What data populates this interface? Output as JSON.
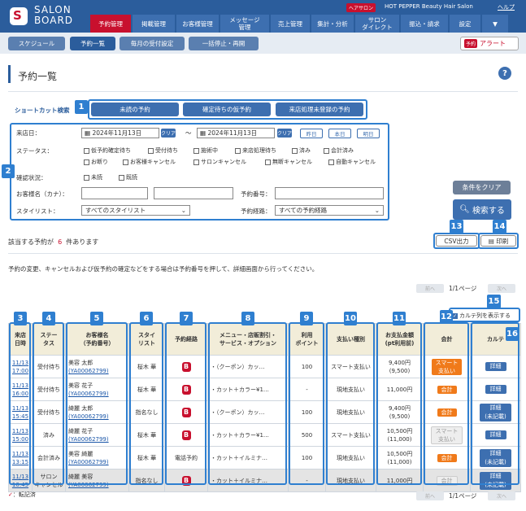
{
  "header": {
    "brand_line1": "SALON",
    "brand_line2": "BOARD",
    "hp_badge": "ヘアサロン",
    "hp_text": "HOT PEPPER Beauty Hair Salon",
    "help": "ヘルプ",
    "nav": [
      "予約管理",
      "掲載管理",
      "お客様管理",
      "メッセージ\n管理",
      "売上管理",
      "集計・分析",
      "サロン\nダイレクト",
      "振込・請求",
      "設定",
      "▼"
    ]
  },
  "subnav": [
    "スケジュール",
    "予約一覧",
    "毎月の受付設定",
    "一括停止・再開"
  ],
  "alert": {
    "badge": "予約",
    "label": "アラート"
  },
  "page_title": "予約一覧",
  "help_icon": "?",
  "shortcut": {
    "label": "ショートカット検索",
    "buttons": [
      "未読の予約",
      "確定待ちの仮予約",
      "来店処理未登録の予約"
    ]
  },
  "search": {
    "visit_date_label": "来店日：",
    "date_from": "2024年11月13日",
    "date_to": "2024年11月13日",
    "clear": "クリア",
    "tilde": "〜",
    "days": [
      "昨日",
      "本日",
      "明日"
    ],
    "status_label": "ステータス：",
    "status_row1": [
      "仮予約確定待ち",
      "受付待ち",
      "施術中",
      "来店処理待ち",
      "済み",
      "会計済み"
    ],
    "status_row2": [
      "お断り",
      "お客様キャンセル",
      "サロンキャンセル",
      "無断キャンセル",
      "自動キャンセル"
    ],
    "read_label": "確認状況：",
    "read_opts": [
      "未読",
      "既読"
    ],
    "name_label": "お客様名（カナ）：",
    "resno_label": "予約番号：",
    "stylist_label": "スタイリスト：",
    "stylist_value": "すべてのスタイリスト",
    "route_label": "予約経路：",
    "route_value": "すべての予約経路",
    "clear_cond": "条件をクリア",
    "search_btn": "検索する"
  },
  "result": {
    "prefix": "該当する予約が",
    "count": "6",
    "suffix": "件あります",
    "csv": "CSV出力",
    "print": "印刷"
  },
  "notice": "予約の変更、キャンセルおよび仮予約の確定などをする場合は予約番号を押して、詳細画面から行ってください。",
  "pager": {
    "prev": "前へ",
    "next": "次へ",
    "page": "1/1ページ"
  },
  "karte_toggle": "カルテ列を表示する",
  "callouts": [
    "1",
    "2",
    "3",
    "4",
    "5",
    "6",
    "7",
    "8",
    "9",
    "10",
    "11",
    "12",
    "13",
    "14",
    "15",
    "16"
  ],
  "table": {
    "headers": [
      "来店\n日時",
      "ステー\nタス",
      "お客様名\n（予約番号）",
      "スタイ\nリスト",
      "予約経路",
      "メニュー・店販割引・\nサービス・オプション",
      "利用\nポイント",
      "支払い種別",
      "お支払金額\n(pt利用前)",
      "会計",
      "カルテ"
    ],
    "rows": [
      {
        "date": "11/13",
        "time": "17:00",
        "status": "受付待ち",
        "name": "美容 太郎",
        "no": "(YA00062799)",
        "stylist": "桜木 華",
        "route": "B",
        "menu": "・（クーポン）カッ…",
        "pt": "100",
        "paytype": "スマート支払い",
        "amount": "9,400円",
        "amount2": "(9,500)",
        "pay": "スマート\n支払い",
        "karte": "詳細"
      },
      {
        "date": "11/13",
        "time": "16:00",
        "status": "受付待ち",
        "name": "美容 花子",
        "no": "(YA00062799)",
        "stylist": "桜木 華",
        "route": "B",
        "menu": "・カット＋カラー¥1…",
        "pt": "-",
        "paytype": "現地支払い",
        "amount": "11,000円",
        "amount2": "",
        "pay": "会計",
        "karte": "詳細"
      },
      {
        "date": "11/13",
        "time": "15:45",
        "status": "受付待ち",
        "name": "綺麗 太郎",
        "no": "(YA00062799)",
        "stylist": "指名なし",
        "route": "B",
        "menu": "・（クーポン）カッ…",
        "pt": "100",
        "paytype": "現地支払い",
        "amount": "9,400円",
        "amount2": "(9,500)",
        "pay": "会計",
        "karte": "詳細\n(未記載)"
      },
      {
        "date": "11/13",
        "time": "15:00",
        "status": "済み",
        "name": "綺麗 花子",
        "no": "(YA00062799)",
        "stylist": "桜木 華",
        "route": "B",
        "menu": "・カット＋カラー¥1…",
        "pt": "500",
        "paytype": "スマート支払い",
        "amount": "10,500円",
        "amount2": "(11,000)",
        "pay": "スマート\n支払い",
        "karte": "詳細"
      },
      {
        "date": "11/13",
        "time": "13:15",
        "status": "会計済み",
        "name": "美容 綺麗",
        "no": "(YA00062799)",
        "stylist": "桜木 華",
        "route": "電話予約",
        "menu": "・カット＋イルミナ…",
        "pt": "100",
        "paytype": "現地支払い",
        "amount": "10,500円",
        "amount2": "(11,000)",
        "pay": "会計",
        "karte": "詳細\n(未記載)"
      },
      {
        "date": "11/13",
        "time": "10:45",
        "status": "サロン\nキャンセル",
        "name": "綺麗 美容",
        "no": "(YA00062799)",
        "stylist": "指名なし",
        "route": "B",
        "menu": "・カット＋イルミナ…",
        "pt": "-",
        "paytype": "現地支払い",
        "amount": "11,000円",
        "amount2": "",
        "pay": "会計",
        "karte": "詳細\n(未記載)"
      }
    ]
  },
  "legend": "：転記済"
}
